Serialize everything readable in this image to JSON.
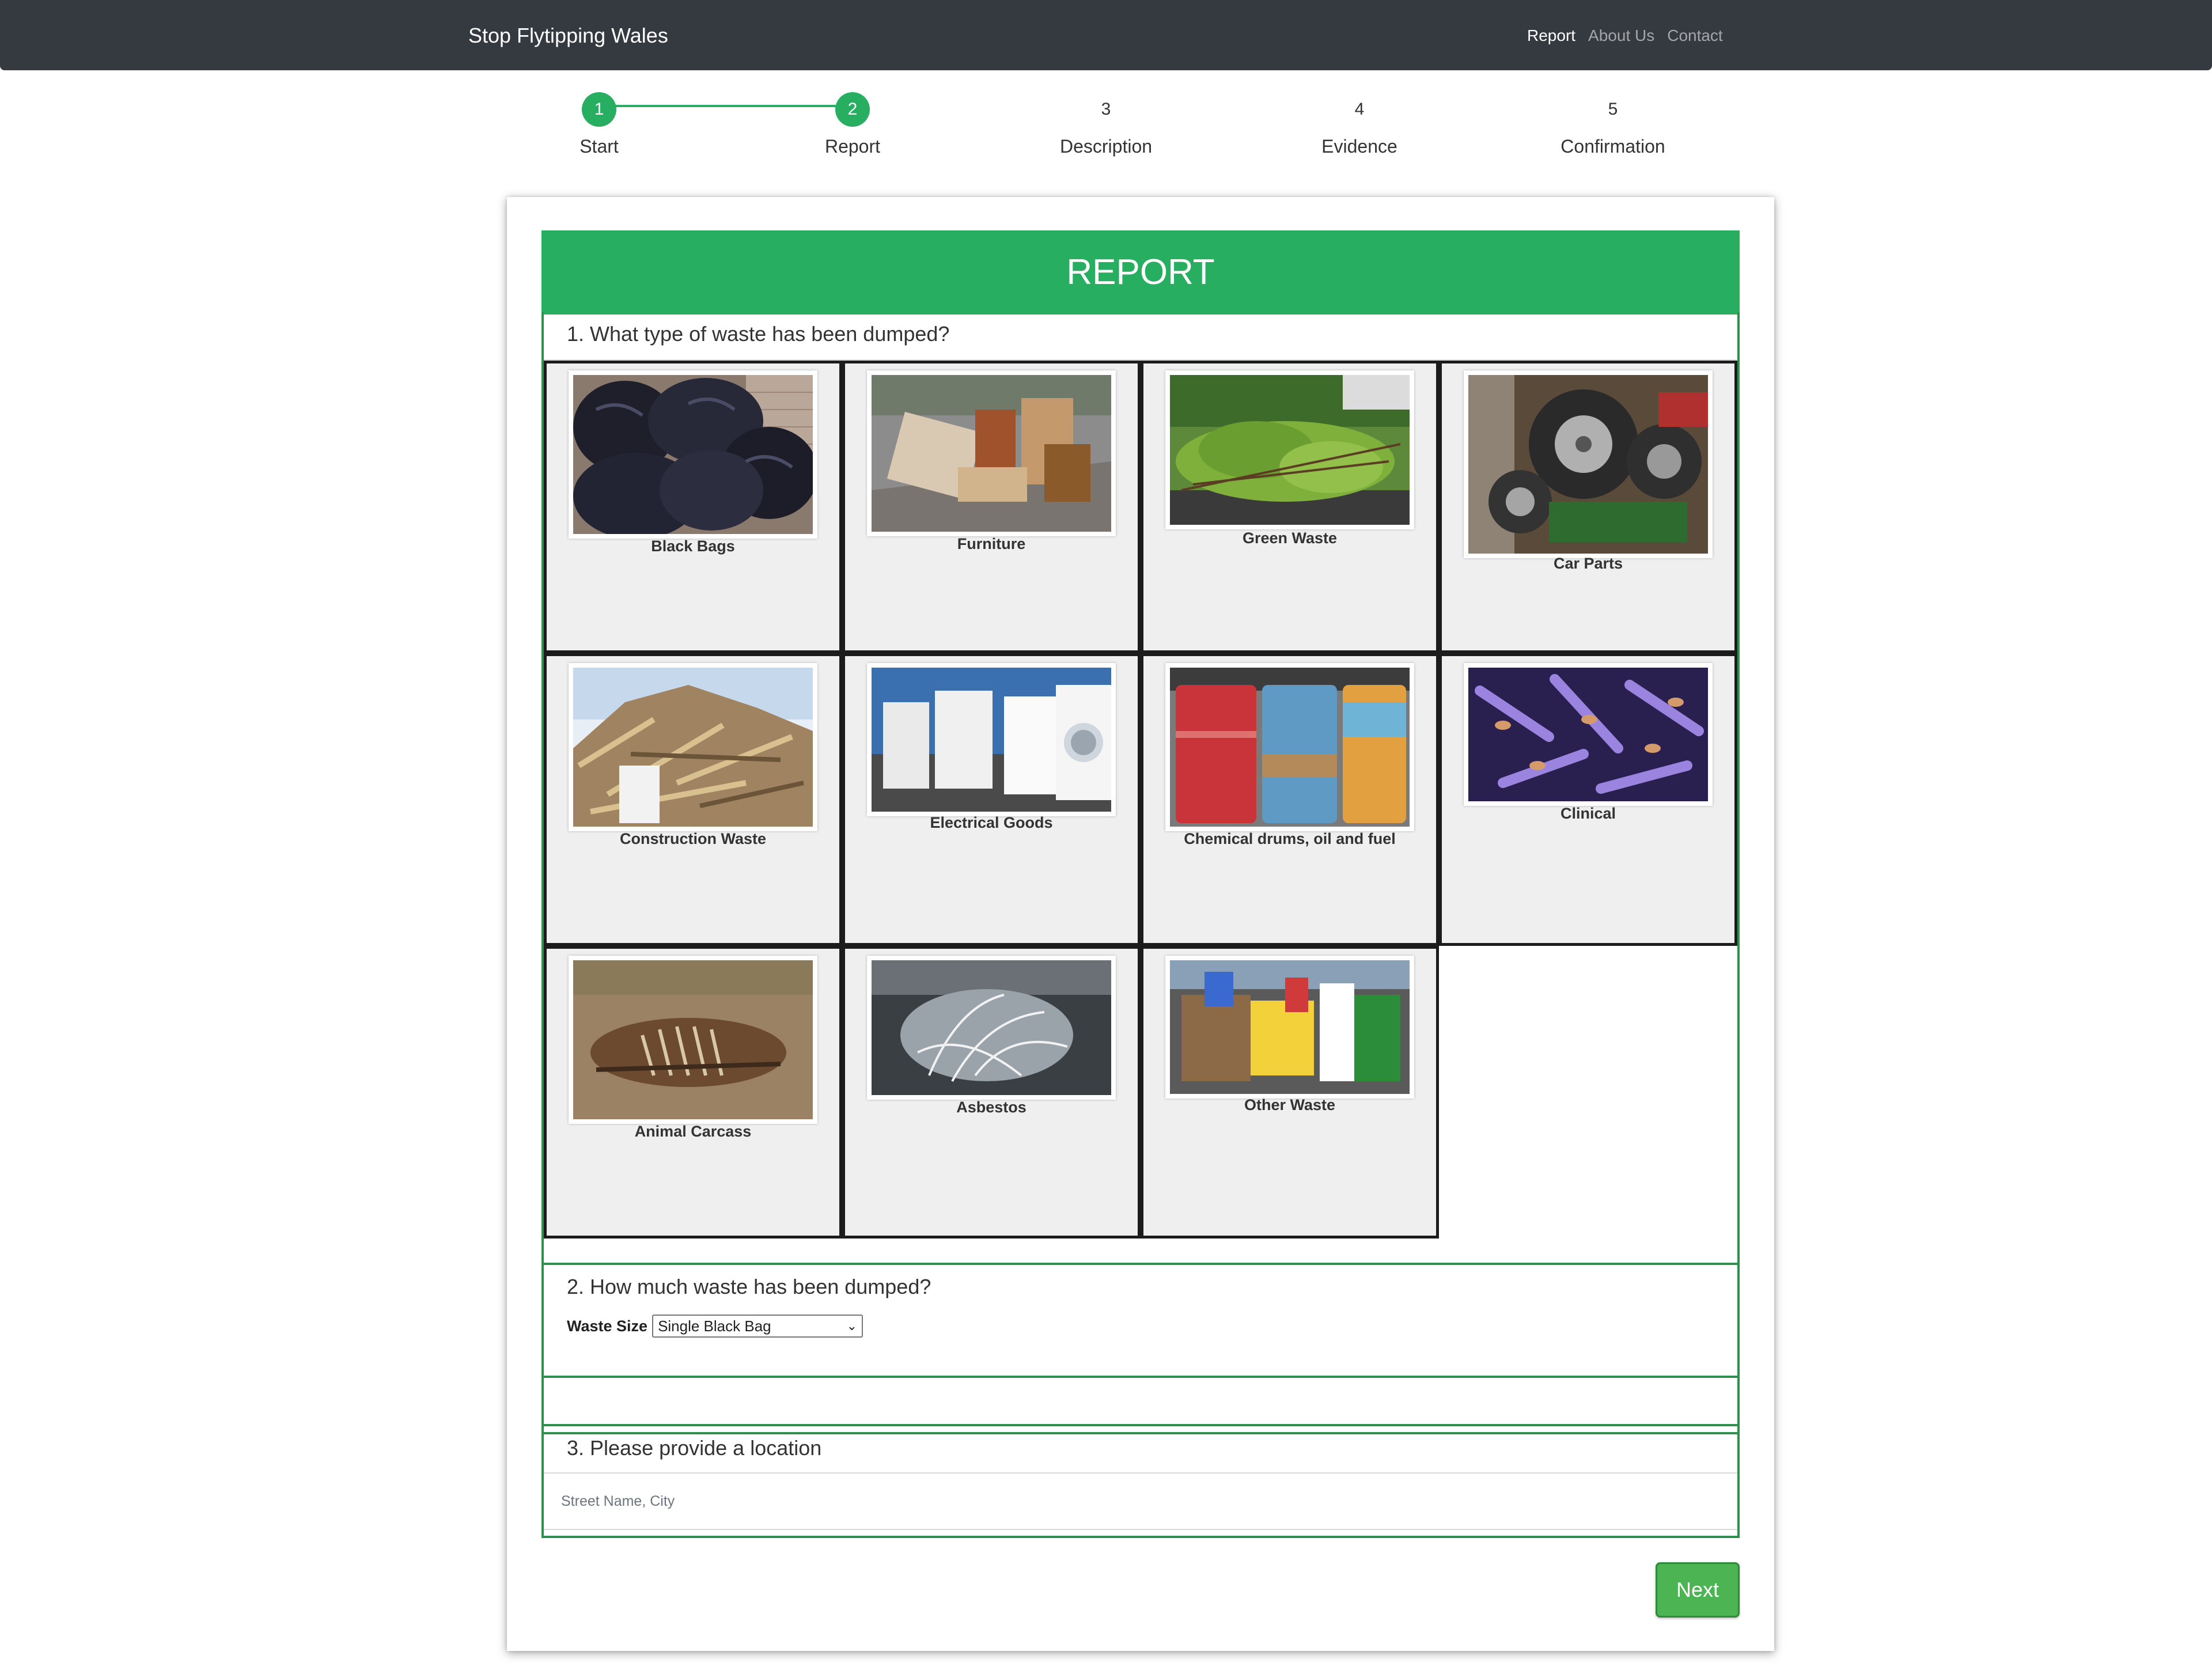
{
  "navbar": {
    "brand": "Stop Flytipping Wales",
    "links": [
      {
        "label": "Report"
      },
      {
        "label": "About Us"
      },
      {
        "label": "Contact"
      }
    ]
  },
  "stepper": {
    "steps": [
      {
        "number": "1",
        "label": "Start"
      },
      {
        "number": "2",
        "label": "Report"
      },
      {
        "number": "3",
        "label": "Description"
      },
      {
        "number": "4",
        "label": "Evidence"
      },
      {
        "number": "5",
        "label": "Confirmation"
      }
    ],
    "current_step": 2
  },
  "report": {
    "heading": "REPORT",
    "q1": {
      "title": "1. What type of waste has been dumped?",
      "options": [
        {
          "label": "Black Bags"
        },
        {
          "label": "Furniture"
        },
        {
          "label": "Green Waste"
        },
        {
          "label": "Car Parts"
        },
        {
          "label": "Construction Waste"
        },
        {
          "label": "Electrical Goods"
        },
        {
          "label": "Chemical drums, oil and fuel"
        },
        {
          "label": "Clinical"
        },
        {
          "label": "Animal Carcass"
        },
        {
          "label": "Asbestos"
        },
        {
          "label": "Other Waste"
        }
      ]
    },
    "q2": {
      "title": "2. How much waste has been dumped?",
      "size_label": "Waste Size",
      "size_selected": "Single Black Bag"
    },
    "q3": {
      "title": "3. Please provide a location",
      "location_placeholder": "Street Name, City"
    },
    "next_label": "Next"
  },
  "colors": {
    "navbar": "#343a40",
    "accent": "#27ae60",
    "section_border": "#2f8f4f",
    "next_button": "#4cb453"
  }
}
